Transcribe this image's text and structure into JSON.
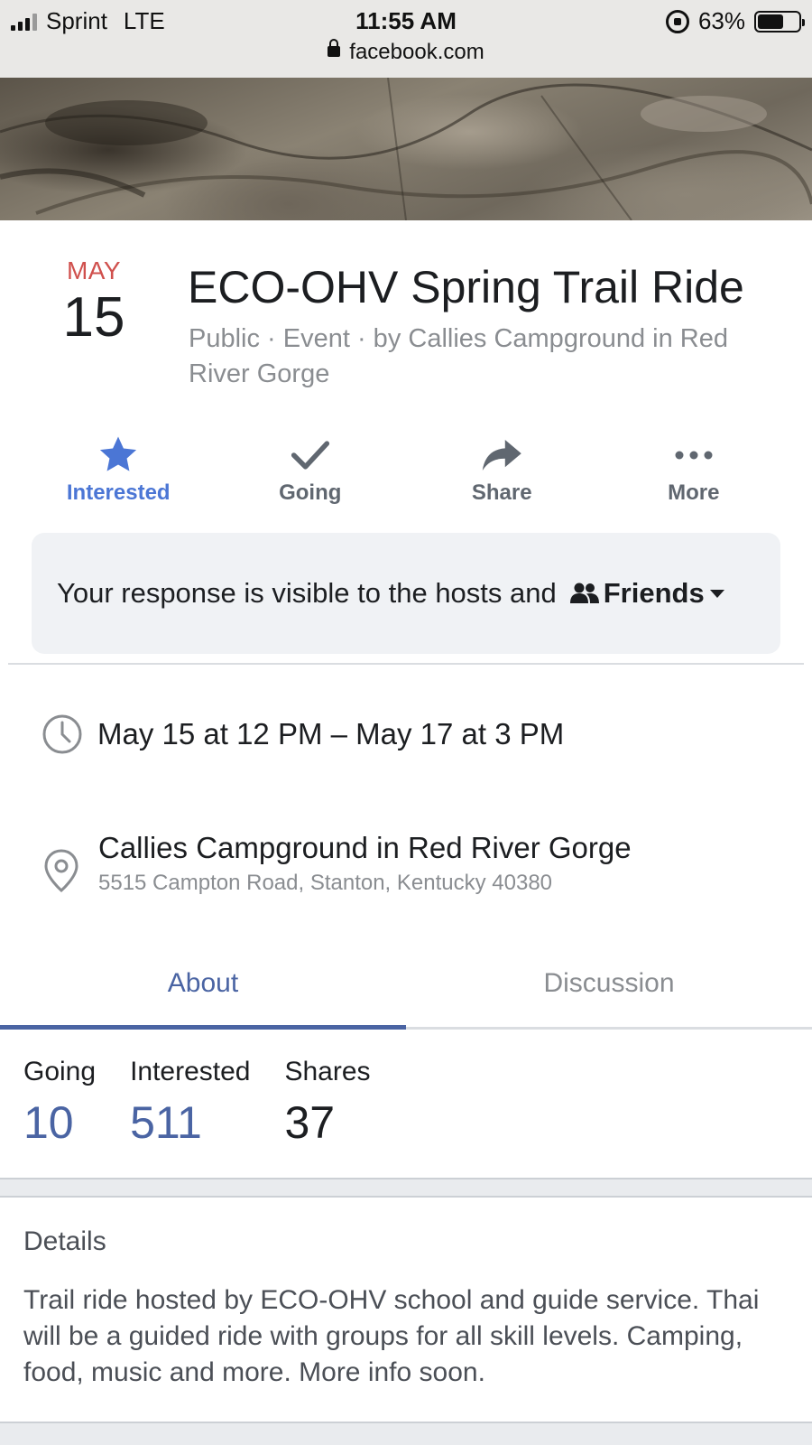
{
  "status_bar": {
    "carrier": "Sprint",
    "network": "LTE",
    "time": "11:55 AM",
    "battery_percent": "63%",
    "battery_level": 0.63,
    "url": "facebook.com"
  },
  "event": {
    "month": "MAY",
    "day": "15",
    "title": "ECO-OHV Spring Trail Ride",
    "subtitle": "Public · Event · by Callies Campground in Red River Gorge"
  },
  "actions": [
    {
      "label": "Interested",
      "icon": "star-icon",
      "active": true
    },
    {
      "label": "Going",
      "icon": "check-icon",
      "active": false
    },
    {
      "label": "Share",
      "icon": "share-arrow-icon",
      "active": false
    },
    {
      "label": "More",
      "icon": "more-dots-icon",
      "active": false
    }
  ],
  "response": {
    "text": "Your response is visible to the hosts and",
    "audience": "Friends"
  },
  "info": {
    "datetime": "May 15 at 12 PM – May 17 at 3 PM",
    "place_name": "Callies Campground in Red River Gorge",
    "place_address": "5515 Campton Road, Stanton, Kentucky 40380"
  },
  "tabs": {
    "about": "About",
    "discussion": "Discussion",
    "active": "about"
  },
  "stats": {
    "going_label": "Going",
    "going_value": "10",
    "interested_label": "Interested",
    "interested_value": "511",
    "shares_label": "Shares",
    "shares_value": "37"
  },
  "details": {
    "heading": "Details",
    "body": "Trail ride hosted by ECO-OHV school and guide service. Thai will be a guided ride with groups for all skill levels. Camping, food, music and more. More info soon."
  },
  "colors": {
    "accent": "#4b76d5",
    "tab_active": "#4a64a3",
    "month": "#d0504d",
    "muted": "#8a8d91"
  }
}
